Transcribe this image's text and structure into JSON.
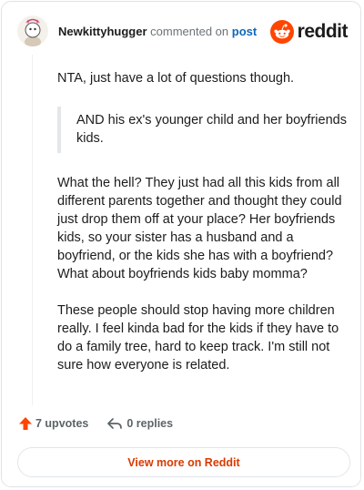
{
  "header": {
    "username": "Newkittyhugger",
    "action_text": "commented on",
    "post_link": "post",
    "brand": "reddit"
  },
  "comment": {
    "intro": "NTA, just have a lot of questions though.",
    "quote": "AND his ex's younger child and her boyfriends kids.",
    "paragraph_2": "What the hell? They just had all this kids from all different parents together and thought they could just drop them off at your place? Her boyfriends kids, so your sister has a husband and a boyfriend, or the kids she has with a boyfriend? What about boyfriends kids baby momma?",
    "paragraph_3": "These people should stop having more children really. I feel kinda bad for the kids if they have to do a family tree, hard to keep track. I'm still not sure how everyone is related."
  },
  "actions": {
    "upvotes": "7 upvotes",
    "replies": "0 replies",
    "upvote_icon": "upvote-arrow-icon",
    "reply_icon": "reply-arrow-icon"
  },
  "footer": {
    "view_more": "View more on Reddit"
  },
  "colors": {
    "brand_orange": "#ff4500",
    "upvote_orange": "#ff4500",
    "link_blue": "#0e68b8",
    "view_more_text": "#d93a00"
  }
}
